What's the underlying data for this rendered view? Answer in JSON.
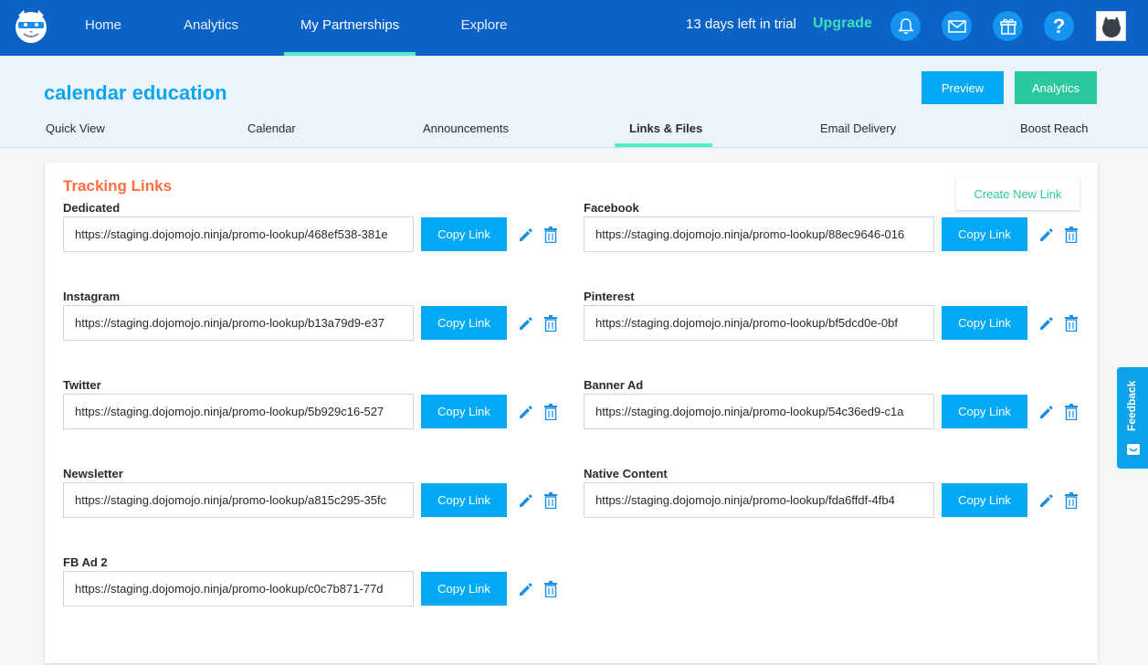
{
  "nav": {
    "links": [
      {
        "label": "Home"
      },
      {
        "label": "Analytics"
      },
      {
        "label": "My Partnerships"
      },
      {
        "label": "Explore"
      }
    ],
    "active_index": 2,
    "trial_text": "13 days left in trial",
    "upgrade_label": "Upgrade",
    "icons": [
      "bell-icon",
      "mail-icon",
      "gift-icon",
      "help-icon"
    ],
    "accent_color": "#54ecc8",
    "bar_color": "#0d62c7"
  },
  "header": {
    "title": "calendar education",
    "preview_label": "Preview",
    "analytics_label": "Analytics",
    "tabs": [
      {
        "label": "Quick View"
      },
      {
        "label": "Calendar"
      },
      {
        "label": "Announcements"
      },
      {
        "label": "Links & Files"
      },
      {
        "label": "Email Delivery"
      },
      {
        "label": "Boost Reach"
      }
    ],
    "active_tab_index": 3
  },
  "tracking": {
    "title": "Tracking Links",
    "create_label": "Create New Link",
    "copy_label": "Copy Link",
    "links": [
      {
        "label": "Dedicated",
        "url": "https://staging.dojomojo.ninja/promo-lookup/468ef538-381e"
      },
      {
        "label": "Facebook",
        "url": "https://staging.dojomojo.ninja/promo-lookup/88ec9646-016"
      },
      {
        "label": "Instagram",
        "url": "https://staging.dojomojo.ninja/promo-lookup/b13a79d9-e37"
      },
      {
        "label": "Pinterest",
        "url": "https://staging.dojomojo.ninja/promo-lookup/bf5dcd0e-0bf"
      },
      {
        "label": "Twitter",
        "url": "https://staging.dojomojo.ninja/promo-lookup/5b929c16-527"
      },
      {
        "label": "Banner Ad",
        "url": "https://staging.dojomojo.ninja/promo-lookup/54c36ed9-c1a"
      },
      {
        "label": "Newsletter",
        "url": "https://staging.dojomojo.ninja/promo-lookup/a815c295-35fc"
      },
      {
        "label": "Native Content",
        "url": "https://staging.dojomojo.ninja/promo-lookup/fda6ffdf-4fb4"
      },
      {
        "label": "FB Ad 2",
        "url": "https://staging.dojomojo.ninja/promo-lookup/c0c7b871-77d"
      }
    ]
  },
  "feedback": {
    "label": "Feedback"
  }
}
